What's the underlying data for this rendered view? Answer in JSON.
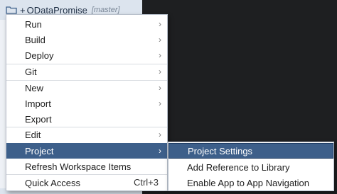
{
  "project": {
    "prefix": "+",
    "name": "ODataPromise",
    "branch": "[master]"
  },
  "context_menu": {
    "items": [
      {
        "label": "Run",
        "has_submenu": true
      },
      {
        "label": "Build",
        "has_submenu": true
      },
      {
        "label": "Deploy",
        "has_submenu": true
      },
      {
        "label": "Git",
        "has_submenu": true
      },
      {
        "label": "New",
        "has_submenu": true
      },
      {
        "label": "Import",
        "has_submenu": true
      },
      {
        "label": "Export",
        "has_submenu": false
      },
      {
        "label": "Edit",
        "has_submenu": true
      },
      {
        "label": "Project",
        "has_submenu": true,
        "active": true
      },
      {
        "label": "Refresh Workspace Items",
        "has_submenu": false
      },
      {
        "label": "Quick Access",
        "shortcut": "Ctrl+3"
      }
    ],
    "arrow_glyph": "›"
  },
  "project_submenu": {
    "items": [
      {
        "label": "Project Settings",
        "active": true
      },
      {
        "label": "Add Reference to Library"
      },
      {
        "label": "Enable App to App Navigation"
      }
    ]
  },
  "colors": {
    "active_bg": "#3d5f8a",
    "menu_bg": "#ffffff",
    "dark_editor": "#1e1f21",
    "tree_bg": "#eef1f6"
  },
  "icons": {
    "folder": "folder-icon",
    "submenu_arrow": "chevron-right-icon"
  }
}
